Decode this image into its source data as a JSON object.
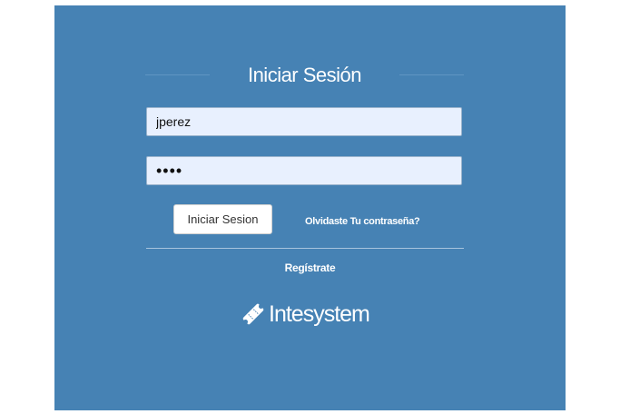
{
  "login": {
    "title": "Iniciar Sesión",
    "username_value": "jperez",
    "password_value": "••••",
    "submit_label": "Iniciar Sesion",
    "forgot_label": "Olvidaste Tu contraseña?",
    "register_label": "Regístrate"
  },
  "brand": {
    "name": "Intesystem",
    "icon": "ticket-icon"
  },
  "colors": {
    "panel_background": "#4682b4",
    "input_background": "#e8f0fe",
    "text_light": "#ffffff"
  }
}
